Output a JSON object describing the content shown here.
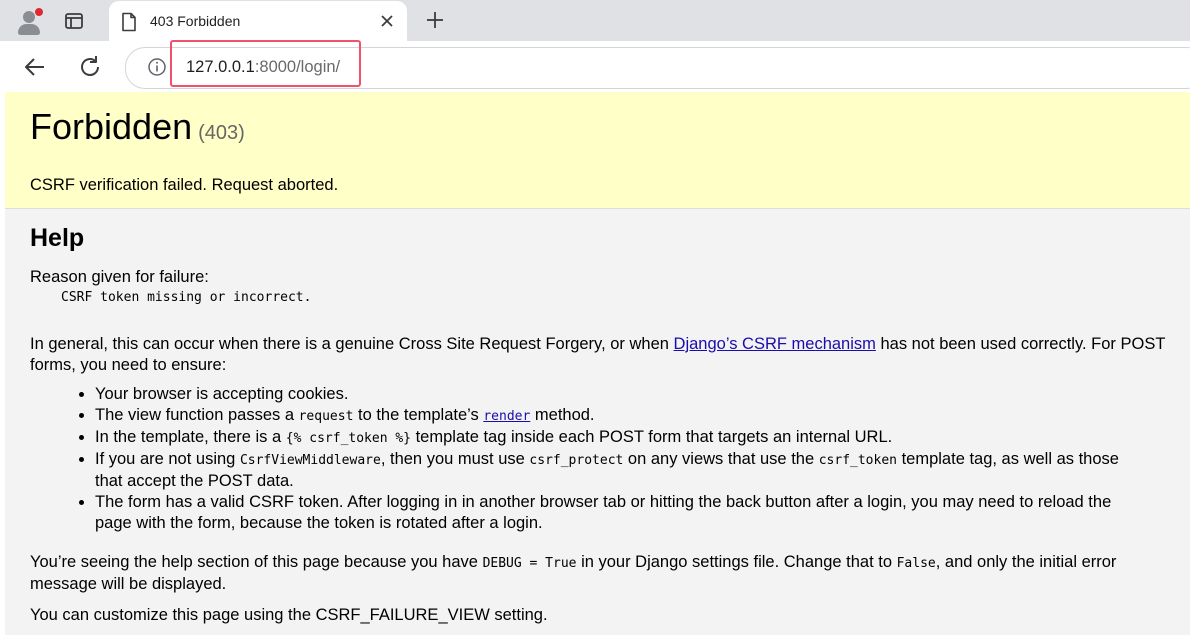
{
  "browser": {
    "tab": {
      "title": "403 Forbidden"
    },
    "address": {
      "host": "127.0.0.1",
      "rest": ":8000/login/"
    }
  },
  "page": {
    "heading": "Forbidden",
    "status_code": "(403)",
    "summary_message": "CSRF verification failed. Request aborted.",
    "help_heading": "Help",
    "reason_label": "Reason given for failure:",
    "reason_value": "CSRF token missing or incorrect.",
    "general": {
      "before_link": "In general, this can occur when there is a genuine Cross Site Request Forgery, or when ",
      "link_text": "Django’s CSRF mechanism",
      "after_link": " has not been used correctly. For POST forms, you need to ensure:"
    },
    "checklist": [
      {
        "text": "Your browser is accepting cookies."
      },
      {
        "a": "The view function passes a ",
        "code": "request",
        "b": " to the template’s ",
        "link": "render",
        "c": " method."
      },
      {
        "a": "In the template, there is a ",
        "code": "{% csrf_token %}",
        "b": " template tag inside each POST form that targets an internal URL."
      },
      {
        "a": "If you are not using ",
        "code1": "CsrfViewMiddleware",
        "b": ", then you must use ",
        "code2": "csrf_protect",
        "c": " on any views that use the ",
        "code3": "csrf_token",
        "d": " template tag, as well as those that accept the POST data."
      },
      {
        "text": "The form has a valid CSRF token. After logging in in another browser tab or hitting the back button after a login, you may need to reload the page with the form, because the token is rotated after a login."
      }
    ],
    "debug_note": {
      "a": "You’re seeing the help section of this page because you have ",
      "code1": "DEBUG = True",
      "b": " in your Django settings file. Change that to ",
      "code2": "False",
      "c": ", and only the initial error message will be displayed."
    },
    "customize_note": "You can customize this page using the CSRF_FAILURE_VIEW setting."
  },
  "colors": {
    "summary_bg": "#ffffc8",
    "info_bg": "#f3f3f3",
    "link": "#1a0dab",
    "url_highlight": "#f0516e"
  },
  "icons": [
    "profile-avatar-icon",
    "tab-actions-icon",
    "page-icon",
    "close-icon",
    "new-tab-icon",
    "back-arrow-icon",
    "reload-icon",
    "site-info-icon"
  ]
}
